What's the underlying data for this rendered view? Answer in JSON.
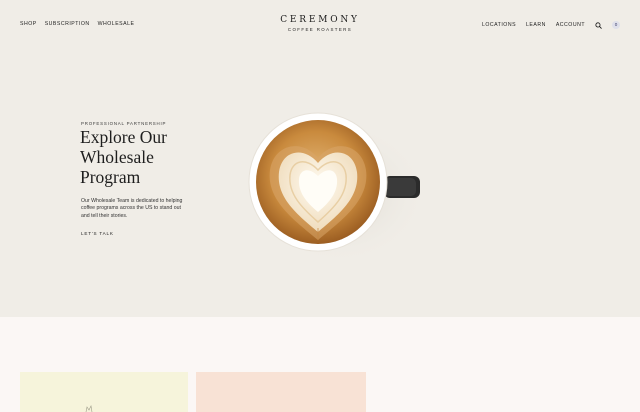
{
  "header": {
    "nav_left": [
      "SHOP",
      "SUBSCRIPTION",
      "WHOLESALE"
    ],
    "logo": {
      "name": "CEREMONY",
      "tagline": "COFFEE ROASTERS"
    },
    "nav_right": [
      "LOCATIONS",
      "LEARN",
      "ACCOUNT"
    ],
    "search_icon": "search-icon",
    "cart_count": "0"
  },
  "hero": {
    "eyebrow": "PROFESSIONAL PARTNERSHIP",
    "title": "Explore Our Wholesale Program",
    "body": "Our Wholesale Team is dedicated to helping coffee programs across the US to stand out and tell their stories.",
    "cta": "LET'S TALK",
    "image": "latte-art-heart-cup"
  },
  "colors": {
    "hero_bg": "#f0ede7",
    "page_bg": "#fbf7f5",
    "card_yellow": "#f6f4db",
    "card_peach": "#f8e2d5",
    "cart_badge": "#dfe0ea"
  }
}
